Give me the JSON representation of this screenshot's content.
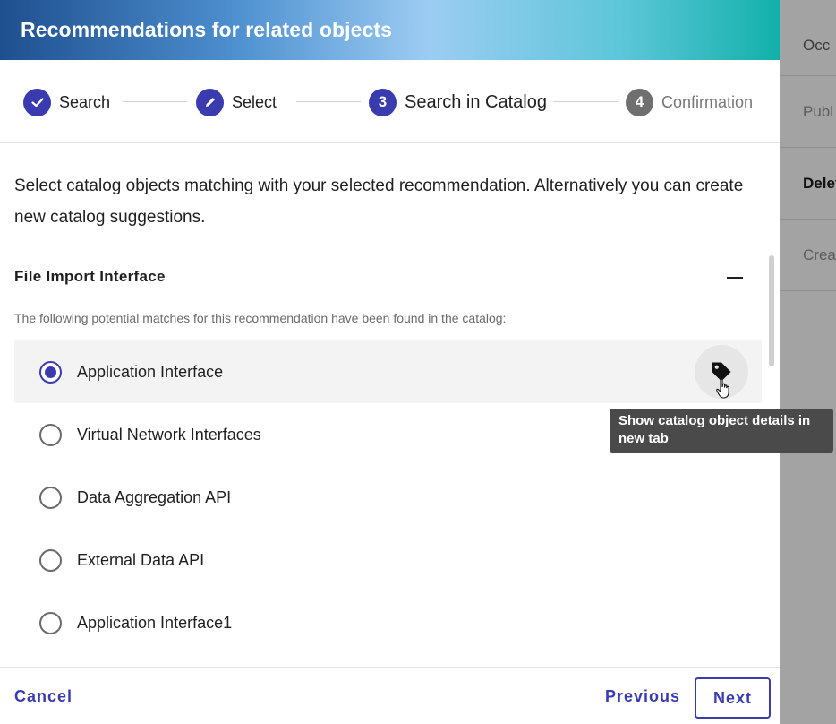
{
  "background": {
    "rows": [
      "Occ",
      "Publ",
      "Delet",
      "Crea"
    ]
  },
  "dialog": {
    "title": "Recommendations for related objects",
    "steps": [
      {
        "label": "Search",
        "state": "done",
        "icon": "check-icon"
      },
      {
        "label": "Select",
        "state": "done",
        "icon": "pencil-icon"
      },
      {
        "number": "3",
        "label": "Search in Catalog",
        "state": "current"
      },
      {
        "number": "4",
        "label": "Confirmation",
        "state": "future"
      }
    ],
    "intro": "Select catalog objects matching with your selected recommendation. Alternatively you can create new catalog suggestions.",
    "section": {
      "title": "File Import Interface",
      "hint": "The following potential matches for this recommendation have been found in the catalog:",
      "options": [
        {
          "label": "Application Interface",
          "selected": true
        },
        {
          "label": "Virtual Network Interfaces",
          "selected": false
        },
        {
          "label": "Data Aggregation API",
          "selected": false
        },
        {
          "label": "External Data API",
          "selected": false
        },
        {
          "label": "Application Interface1",
          "selected": false
        }
      ]
    },
    "tooltip": "Show catalog object details in new tab",
    "footer": {
      "cancel": "Cancel",
      "previous": "Previous",
      "next": "Next"
    }
  },
  "colors": {
    "accent": "#3b3bb0",
    "inactive_step": "#6f6f6f",
    "tooltip_bg": "#4a4a4a"
  }
}
